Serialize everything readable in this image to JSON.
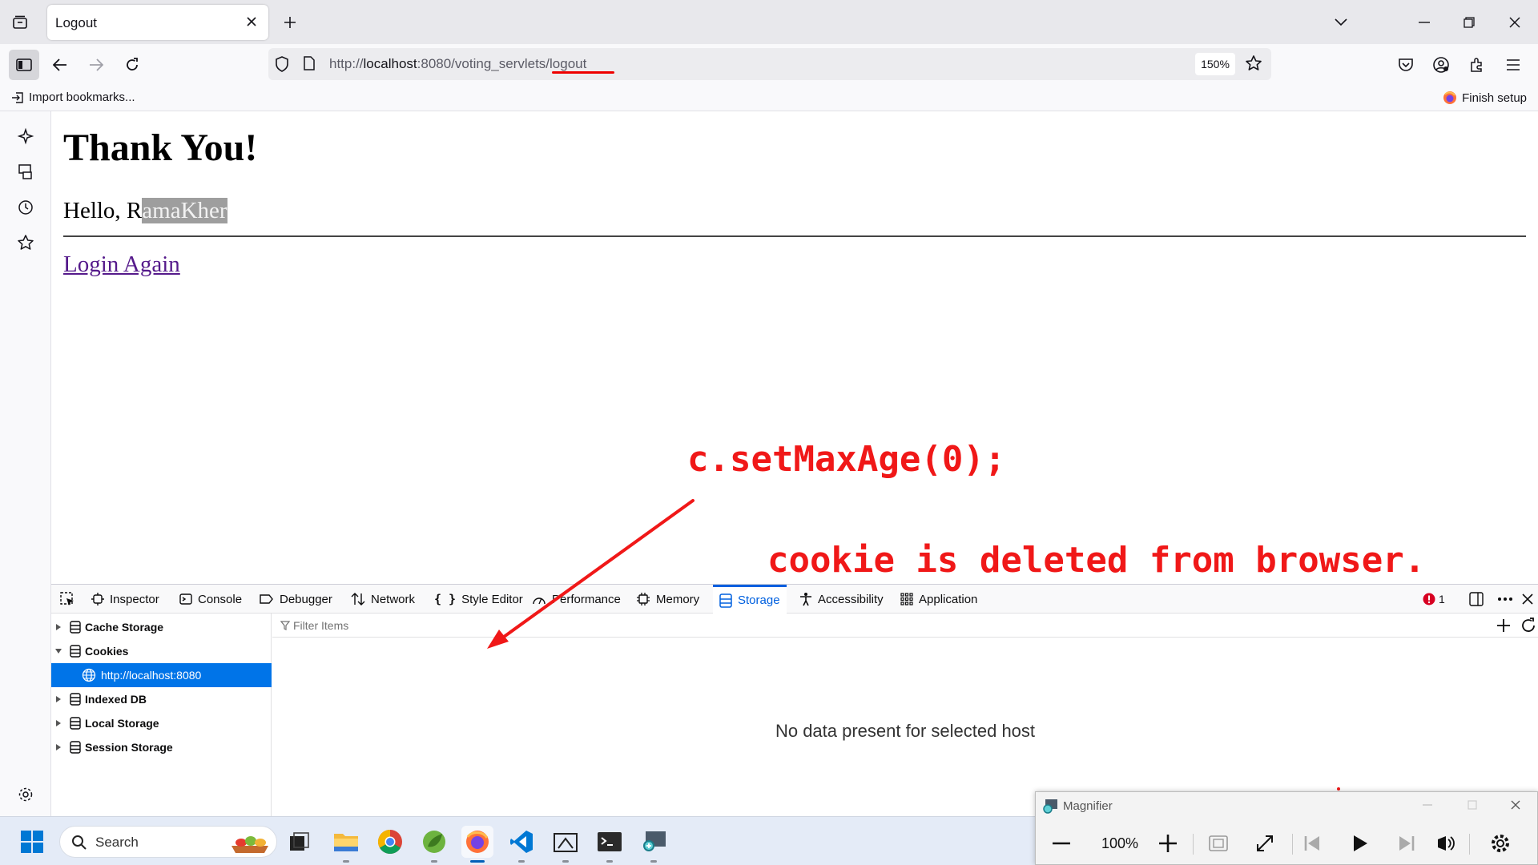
{
  "browser": {
    "tab_title": "Logout",
    "url_prefix": "http://",
    "url_host": "localhost",
    "url_rest": ":8080/voting_servlets/",
    "url_path_end": "logout",
    "zoom": "150%"
  },
  "bookmarks": {
    "import_label": "Import bookmarks...",
    "finish_label": "Finish setup"
  },
  "page": {
    "heading": "Thank You!",
    "hello_prefix": "Hello, R",
    "hello_selected": "amaKher",
    "link": "Login Again"
  },
  "annotations": {
    "code": "c.setMaxAge(0);",
    "note": "cookie is deleted from browser."
  },
  "devtools": {
    "tabs": [
      "Inspector",
      "Console",
      "Debugger",
      "Network",
      "Style Editor",
      "Performance",
      "Memory",
      "Storage",
      "Accessibility",
      "Application"
    ],
    "active_tab": "Storage",
    "error_count": "1",
    "tree": [
      "Cache Storage",
      "Cookies",
      "http://localhost:8080",
      "Indexed DB",
      "Local Storage",
      "Session Storage"
    ],
    "selected_tree_item": "http://localhost:8080",
    "filter_placeholder": "Filter Items",
    "empty_message": "No data present for selected host"
  },
  "taskbar": {
    "search_label": "Search"
  },
  "magnifier": {
    "title": "Magnifier",
    "zoom": "100%"
  },
  "colors": {
    "annotation": "#f01818",
    "devtools_accent": "#0060df",
    "tree_selected": "#0074e8",
    "visited_link": "#551a8b"
  }
}
